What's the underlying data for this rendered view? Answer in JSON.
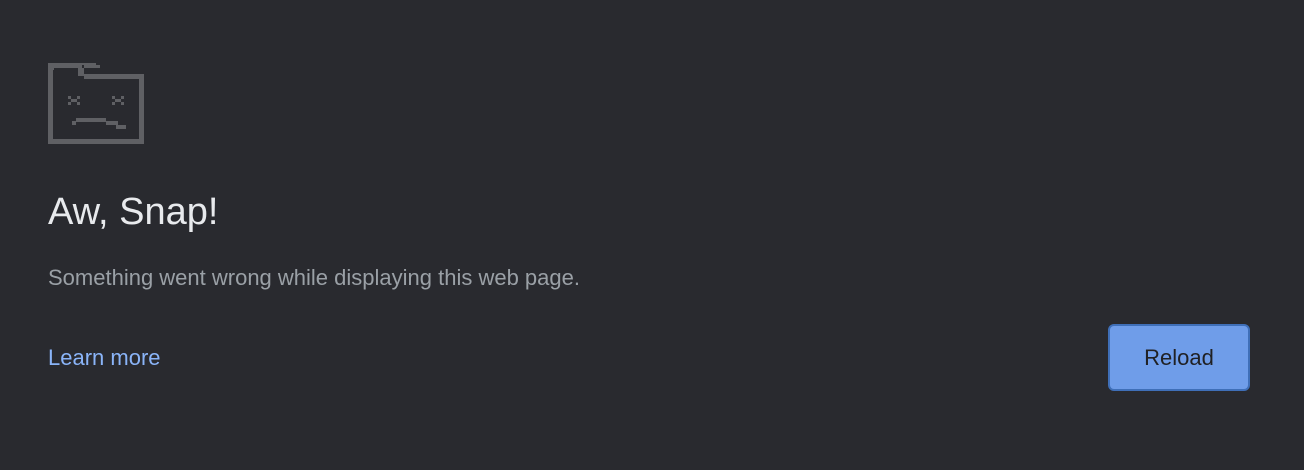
{
  "page": {
    "title": "Aw, Snap!",
    "message": "Something went wrong while displaying this web page.",
    "learn_more_label": "Learn more",
    "reload_label": "Reload"
  },
  "icons": {
    "sad_tab": "sad-tab-icon"
  },
  "colors": {
    "background": "#292a2f",
    "title": "#e8eaed",
    "message": "#9aa0a6",
    "link": "#8ab4f8",
    "button": "#6f9de9",
    "icon": "#5f6064"
  }
}
